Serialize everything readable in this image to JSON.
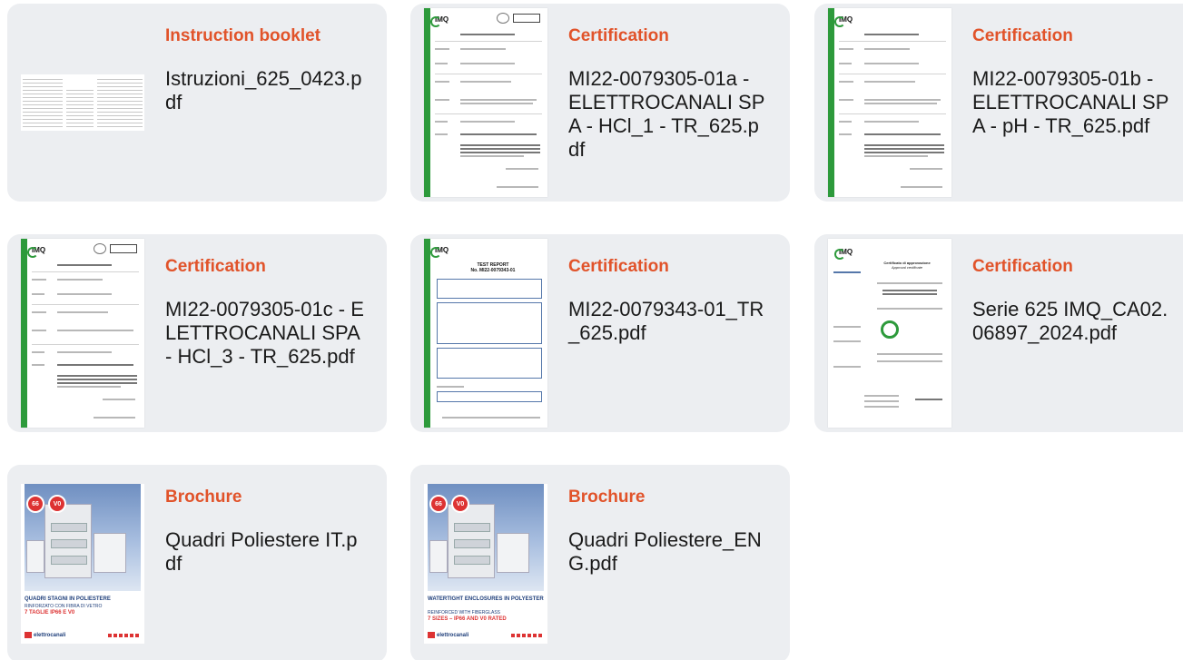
{
  "documents": [
    {
      "category": "Instruction booklet",
      "filename": "Istruzioni_625_0423.pdf",
      "thumb_type": "booklet"
    },
    {
      "category": "Certification",
      "filename": "MI22-0079305-01a - ELETTROCANALI SPA - HCl_1 - TR_625.pdf",
      "thumb_type": "imq-report"
    },
    {
      "category": "Certification",
      "filename": "MI22-0079305-01b - ELETTROCANALI SPA - pH - TR_625.pdf",
      "thumb_type": "imq-report"
    },
    {
      "category": "Certification",
      "filename": "MI22-0079305-01c - ELETTROCANALI SPA - HCl_3 - TR_625.pdf",
      "thumb_type": "imq-report"
    },
    {
      "category": "Certification",
      "filename": "MI22-0079343-01_TR_625.pdf",
      "thumb_type": "test-report"
    },
    {
      "category": "Certification",
      "filename": "Serie 625 IMQ_CA02.06897_2024.pdf",
      "thumb_type": "imq-certificate"
    },
    {
      "category": "Brochure",
      "filename": "Quadri Poliestere IT.pdf",
      "thumb_type": "brochure",
      "brochure": {
        "headline": "QUADRI STAGNI IN POLIESTERE",
        "sub": "RINFORZATO CON FIBRA DI VETRO",
        "accent": "7 TAGLIE IP66 E V0",
        "badges": [
          "66",
          "V0"
        ],
        "brand": "elettrocanali"
      }
    },
    {
      "category": "Brochure",
      "filename": "Quadri Poliestere_ENG.pdf",
      "thumb_type": "brochure",
      "brochure": {
        "headline": "WATERTIGHT ENCLOSURES IN POLYESTER",
        "sub": "REINFORCED WITH FIBERGLASS",
        "accent": "7 SIZES – IP66 AND V0 RATED",
        "badges": [
          "66",
          "V0"
        ],
        "brand": "elettrocanali"
      }
    }
  ],
  "test_report": {
    "heading": "TEST REPORT",
    "number": "No. MI22-0079343-01"
  },
  "certificate": {
    "title": "Certificato di approvazione",
    "subtitle": "Approval certificate"
  },
  "colors": {
    "accent": "#e1532a",
    "card_bg": "#eceef1",
    "imq_green": "#2d9a3b",
    "brochure_blue": "#1e3e7a",
    "brochure_red": "#d33333"
  }
}
